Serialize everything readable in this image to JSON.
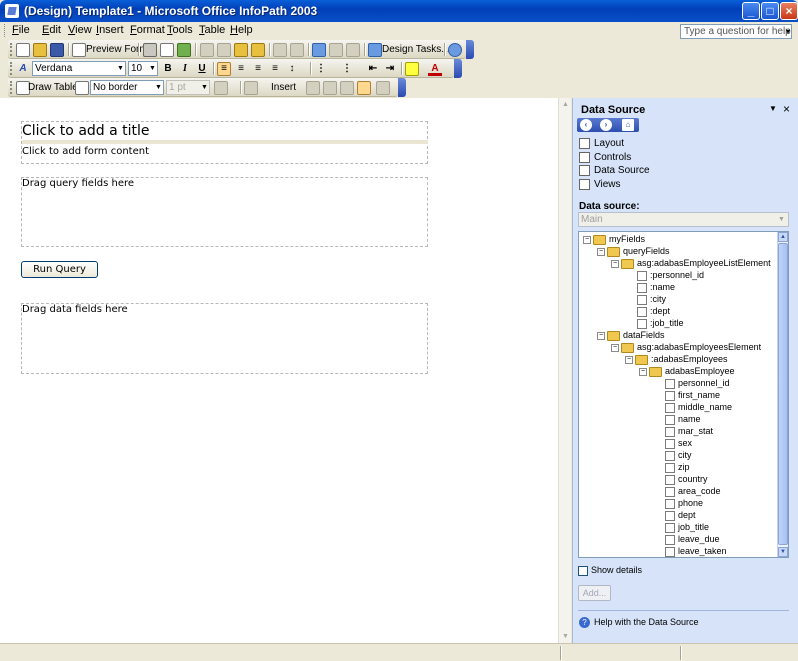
{
  "window": {
    "title": "(Design) Template1 - Microsoft Office InfoPath 2003"
  },
  "menu": [
    "File",
    "Edit",
    "View",
    "Insert",
    "Format",
    "Tools",
    "Table",
    "Help"
  ],
  "help_box": {
    "placeholder": "Type a question for help"
  },
  "toolbar_standard": {
    "preview_label": "Preview Form",
    "design_tasks_label": "Design Tasks..."
  },
  "toolbar_format": {
    "font": "Verdana",
    "size": "10",
    "bold": "B",
    "italic": "I",
    "underline": "U",
    "style_icon": "A"
  },
  "toolbar_table": {
    "draw_table_label": "Draw Table",
    "border_style": "No border",
    "border_width": "1 pt",
    "insert_label": "Insert"
  },
  "form": {
    "title_placeholder": "Click to add a title",
    "content_placeholder": "Click to add form content",
    "query_hint": "Drag query fields here",
    "run_query_label": "Run Query",
    "data_hint": "Drag data fields here"
  },
  "task_pane": {
    "title": "Data Source",
    "links": [
      "Layout",
      "Controls",
      "Data Source",
      "Views"
    ],
    "data_source_label": "Data source:",
    "data_source_value": "Main",
    "show_details_label": "Show details",
    "add_label": "Add...",
    "help_link": "Help with the Data Source"
  },
  "tree": [
    {
      "label": "myFields",
      "depth": 0,
      "kind": "folder",
      "toggle": "−"
    },
    {
      "label": "queryFields",
      "depth": 1,
      "kind": "folder",
      "toggle": "−"
    },
    {
      "label": "asg:adabasEmployeeListElement",
      "depth": 2,
      "kind": "folder",
      "toggle": "−"
    },
    {
      "label": ":personnel_id",
      "depth": 3,
      "kind": "field"
    },
    {
      "label": ":name",
      "depth": 3,
      "kind": "field"
    },
    {
      "label": ":city",
      "depth": 3,
      "kind": "field"
    },
    {
      "label": ":dept",
      "depth": 3,
      "kind": "field"
    },
    {
      "label": ":job_title",
      "depth": 3,
      "kind": "field"
    },
    {
      "label": "dataFields",
      "depth": 1,
      "kind": "folder",
      "toggle": "−"
    },
    {
      "label": "asg:adabasEmployeesElement",
      "depth": 2,
      "kind": "folder",
      "toggle": "−"
    },
    {
      "label": ":adabasEmployees",
      "depth": 3,
      "kind": "folder",
      "toggle": "−"
    },
    {
      "label": "adabasEmployee",
      "depth": 4,
      "kind": "folder",
      "toggle": "−"
    },
    {
      "label": "personnel_id",
      "depth": 5,
      "kind": "field"
    },
    {
      "label": "first_name",
      "depth": 5,
      "kind": "field"
    },
    {
      "label": "middle_name",
      "depth": 5,
      "kind": "field"
    },
    {
      "label": "name",
      "depth": 5,
      "kind": "field"
    },
    {
      "label": "mar_stat",
      "depth": 5,
      "kind": "field"
    },
    {
      "label": "sex",
      "depth": 5,
      "kind": "field"
    },
    {
      "label": "city",
      "depth": 5,
      "kind": "field"
    },
    {
      "label": "zip",
      "depth": 5,
      "kind": "field"
    },
    {
      "label": "country",
      "depth": 5,
      "kind": "field"
    },
    {
      "label": "area_code",
      "depth": 5,
      "kind": "field"
    },
    {
      "label": "phone",
      "depth": 5,
      "kind": "field"
    },
    {
      "label": "dept",
      "depth": 5,
      "kind": "field"
    },
    {
      "label": "job_title",
      "depth": 5,
      "kind": "field"
    },
    {
      "label": "leave_due",
      "depth": 5,
      "kind": "field"
    },
    {
      "label": "leave_taken",
      "depth": 5,
      "kind": "field"
    }
  ]
}
